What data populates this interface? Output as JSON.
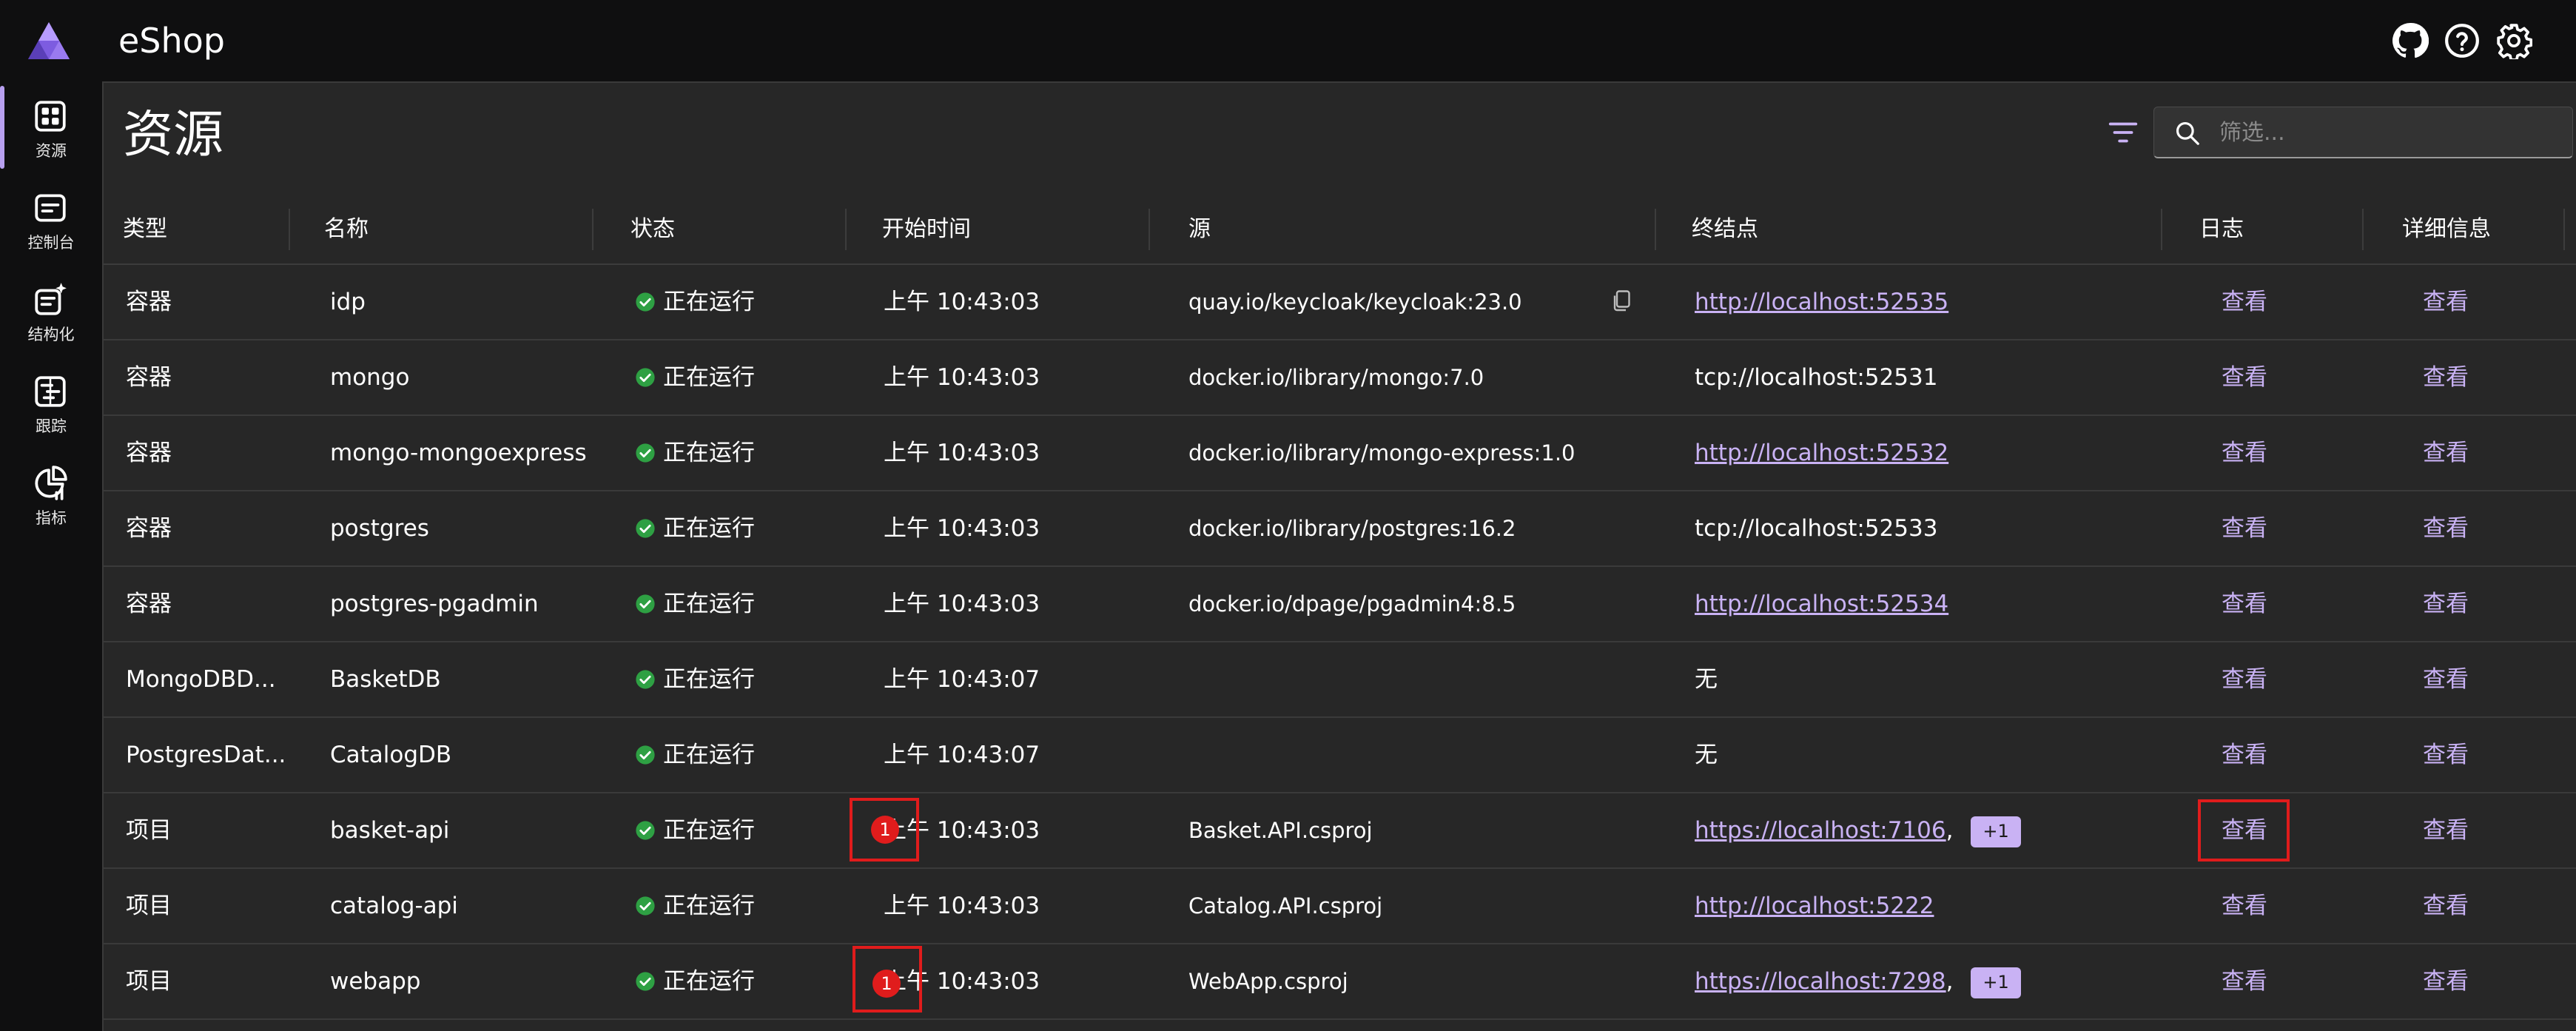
{
  "app": {
    "title": "eShop",
    "icons": [
      "github-icon",
      "help-icon",
      "settings-icon"
    ]
  },
  "sidebar": {
    "items": [
      {
        "label": "资源",
        "icon": "resources-icon",
        "active": true
      },
      {
        "label": "控制台",
        "icon": "console-icon",
        "active": false
      },
      {
        "label": "结构化",
        "icon": "structured-icon",
        "active": false
      },
      {
        "label": "跟踪",
        "icon": "traces-icon",
        "active": false
      },
      {
        "label": "指标",
        "icon": "metrics-icon",
        "active": false
      }
    ]
  },
  "page": {
    "title": "资源",
    "search_placeholder": "筛选..."
  },
  "table": {
    "columns": [
      "类型",
      "名称",
      "状态",
      "开始时间",
      "源",
      "终结点",
      "日志",
      "详细信息"
    ],
    "rows": [
      {
        "type": "容器",
        "name": "idp",
        "state": "正在运行",
        "start": "上午 10:43:03",
        "source": "quay.io/keycloak/keycloak:23.0",
        "endpoint": "http://localhost:52535",
        "endpoint_link": true,
        "logs": "查看",
        "details": "查看"
      },
      {
        "type": "容器",
        "name": "mongo",
        "state": "正在运行",
        "start": "上午 10:43:03",
        "source": "docker.io/library/mongo:7.0",
        "endpoint": "tcp://localhost:52531",
        "endpoint_link": false,
        "logs": "查看",
        "details": "查看"
      },
      {
        "type": "容器",
        "name": "mongo-mongoexpress",
        "state": "正在运行",
        "start": "上午 10:43:03",
        "source": "docker.io/library/mongo-express:1.0",
        "endpoint": "http://localhost:52532",
        "endpoint_link": true,
        "logs": "查看",
        "details": "查看"
      },
      {
        "type": "容器",
        "name": "postgres",
        "state": "正在运行",
        "start": "上午 10:43:03",
        "source": "docker.io/library/postgres:16.2",
        "endpoint": "tcp://localhost:52533",
        "endpoint_link": false,
        "logs": "查看",
        "details": "查看"
      },
      {
        "type": "容器",
        "name": "postgres-pgadmin",
        "state": "正在运行",
        "start": "上午 10:43:03",
        "source": "docker.io/dpage/pgadmin4:8.5",
        "endpoint": "http://localhost:52534",
        "endpoint_link": true,
        "logs": "查看",
        "details": "查看"
      },
      {
        "type": "MongoDBD...",
        "name": "BasketDB",
        "state": "正在运行",
        "start": "上午 10:43:07",
        "source": "",
        "endpoint": "无",
        "endpoint_link": false,
        "logs": "查看",
        "details": "查看"
      },
      {
        "type": "PostgresDat...",
        "name": "CatalogDB",
        "state": "正在运行",
        "start": "上午 10:43:07",
        "source": "",
        "endpoint": "无",
        "endpoint_link": false,
        "logs": "查看",
        "details": "查看"
      },
      {
        "type": "项目",
        "name": "basket-api",
        "state": "正在运行",
        "start": "上午 10:43:03",
        "source": "Basket.API.csproj",
        "endpoint": "https://localhost:7106",
        "endpoint_link": true,
        "endpoint_suffix": ",",
        "extra": "+1",
        "error_count": "1",
        "logs": "查看",
        "details": "查看"
      },
      {
        "type": "项目",
        "name": "catalog-api",
        "state": "正在运行",
        "start": "上午 10:43:03",
        "source": "Catalog.API.csproj",
        "endpoint": "http://localhost:5222",
        "endpoint_link": true,
        "logs": "查看",
        "details": "查看"
      },
      {
        "type": "项目",
        "name": "webapp",
        "state": "正在运行",
        "start": "上午 10:43:03",
        "source": "WebApp.csproj",
        "endpoint": "https://localhost:7298",
        "endpoint_link": true,
        "endpoint_suffix": ",",
        "extra": "+1",
        "error_count": "1",
        "logs": "查看",
        "details": "查看"
      }
    ]
  },
  "colors": {
    "accent": "#c9b2f4",
    "running": "#2ea043",
    "error": "#e01c1c"
  }
}
